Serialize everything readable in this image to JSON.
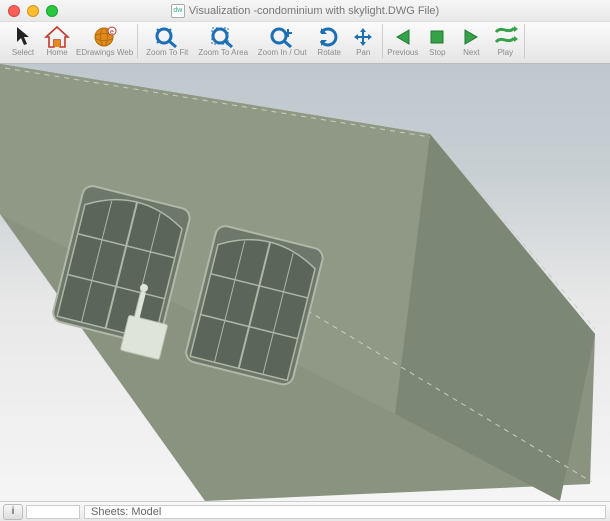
{
  "window": {
    "title": "Visualization -condominium with skylight.DWG File)"
  },
  "toolbar": {
    "select": "Select",
    "home": "Home",
    "edrawings_web": "EDrawings Web",
    "zoom_fit": "Zoom To Fit",
    "zoom_area": "Zoom To Area",
    "zoom_inout": "Zoom In / Out",
    "rotate": "Rotate",
    "pan": "Pan",
    "previous": "Previous",
    "stop": "Stop",
    "next": "Next",
    "play": "Play"
  },
  "status": {
    "sheets_label": "Sheets:",
    "sheets_value": "Model"
  },
  "colors": {
    "icon_blue": "#1b6fb5",
    "icon_green": "#35a24a",
    "icon_orange": "#e28a1c",
    "model_face": "#8a937f",
    "model_side": "#7d8775"
  }
}
